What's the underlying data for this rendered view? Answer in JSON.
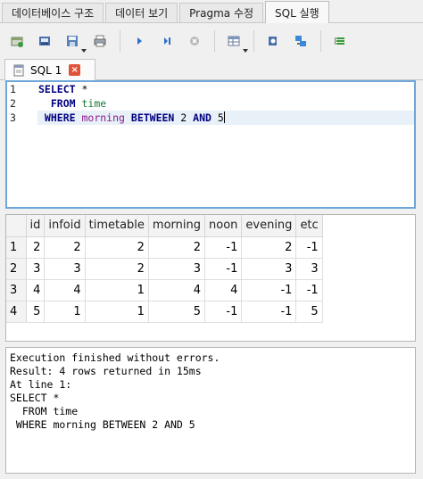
{
  "main_tabs": [
    {
      "label": "데이터베이스 구조",
      "active": false
    },
    {
      "label": "데이터 보기",
      "active": false
    },
    {
      "label": "Pragma 수정",
      "active": false
    },
    {
      "label": "SQL 실행",
      "active": true
    }
  ],
  "toolbar": {
    "buttons": [
      {
        "icon": "open-tab-icon"
      },
      {
        "icon": "open-sql-icon"
      },
      {
        "icon": "save-sql-icon",
        "dropdown": true
      },
      {
        "icon": "print-icon"
      },
      {
        "icon": "execute-all-icon"
      },
      {
        "icon": "execute-current-icon"
      },
      {
        "icon": "stop-icon"
      },
      {
        "icon": "save-results-icon",
        "dropdown": true
      },
      {
        "icon": "find-icon"
      },
      {
        "icon": "find-replace-icon"
      },
      {
        "icon": "comment-icon"
      }
    ]
  },
  "sql_tab": {
    "label": "SQL 1",
    "close_glyph": "×"
  },
  "editor": {
    "line_numbers": [
      "1",
      "2",
      "3"
    ],
    "lines": [
      {
        "tokens": [
          {
            "t": "SELECT",
            "c": "kw"
          },
          {
            "t": " *",
            "c": ""
          }
        ]
      },
      {
        "tokens": [
          {
            "t": "  FROM",
            "c": "kw"
          },
          {
            "t": " ",
            "c": ""
          },
          {
            "t": "time",
            "c": "tb"
          }
        ]
      },
      {
        "tokens": [
          {
            "t": " WHERE",
            "c": "kw"
          },
          {
            "t": " ",
            "c": ""
          },
          {
            "t": "morning",
            "c": "col"
          },
          {
            "t": " ",
            "c": ""
          },
          {
            "t": "BETWEEN",
            "c": "kw"
          },
          {
            "t": " 2 ",
            "c": "num"
          },
          {
            "t": "AND",
            "c": "kw"
          },
          {
            "t": " 5",
            "c": "num"
          }
        ]
      }
    ]
  },
  "grid": {
    "columns": [
      "id",
      "infoid",
      "timetable",
      "morning",
      "noon",
      "evening",
      "etc"
    ],
    "rows": [
      {
        "num": "1",
        "cells": [
          "2",
          "2",
          "2",
          "2",
          "-1",
          "2",
          "-1"
        ]
      },
      {
        "num": "2",
        "cells": [
          "3",
          "3",
          "2",
          "3",
          "-1",
          "3",
          "3"
        ]
      },
      {
        "num": "3",
        "cells": [
          "4",
          "4",
          "1",
          "4",
          "4",
          "-1",
          "-1"
        ]
      },
      {
        "num": "4",
        "cells": [
          "5",
          "1",
          "1",
          "5",
          "-1",
          "-1",
          "5"
        ]
      }
    ]
  },
  "log": {
    "lines": [
      "Execution finished without errors.",
      "Result: 4 rows returned in 15ms",
      "At line 1:",
      "SELECT *",
      "  FROM time",
      " WHERE morning BETWEEN 2 AND 5"
    ]
  },
  "colors": {
    "accent_border": "#6ea6d8",
    "close_red": "#e0533a",
    "keyword": "#00007f",
    "table_name": "#1a7a3a",
    "column_name": "#8b1a8b"
  }
}
